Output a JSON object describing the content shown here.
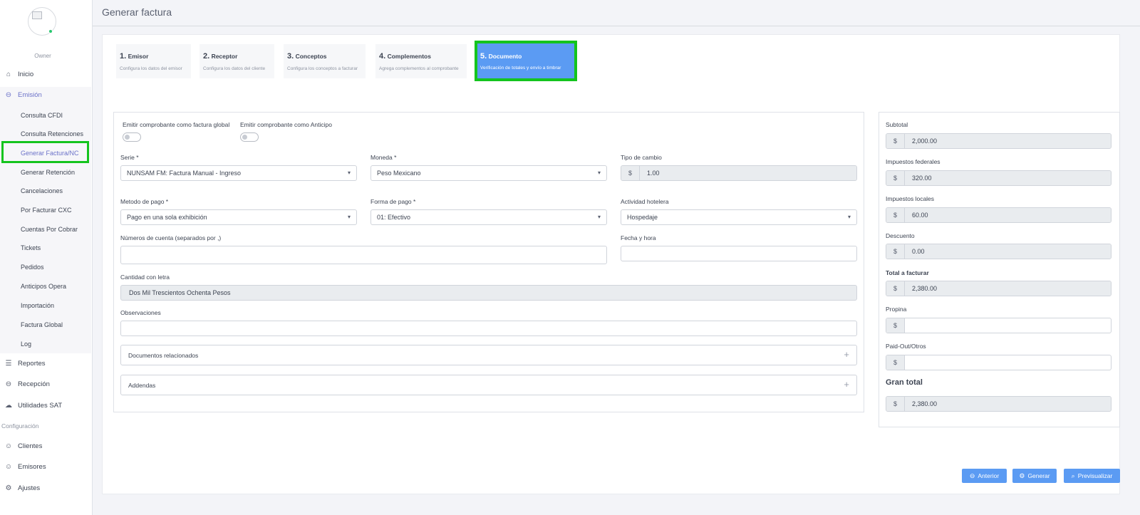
{
  "sidebar": {
    "role": "Owner",
    "nav": {
      "inicio": "Inicio",
      "emision": "Emisión",
      "reportes": "Reportes",
      "recepcion": "Recepción",
      "utilidades": "Utilidades SAT",
      "clientes": "Clientes",
      "emisores": "Emisores",
      "ajustes": "Ajustes"
    },
    "submenu": [
      "Consulta CFDI",
      "Consulta Retenciones",
      "Generar Factura/NC",
      "Generar Retención",
      "Cancelaciones",
      "Por Facturar CXC",
      "Cuentas Por Cobrar",
      "Tickets",
      "Pedidos",
      "Anticipos Opera",
      "Importación",
      "Factura Global",
      "Log"
    ],
    "config_label": "Configuración"
  },
  "header": {
    "title": "Generar factura"
  },
  "steps": [
    {
      "num": "1.",
      "title": "Emisor",
      "desc": "Configura los datos del emisor"
    },
    {
      "num": "2.",
      "title": "Receptor",
      "desc": "Configura los datos del cliente"
    },
    {
      "num": "3.",
      "title": "Conceptos",
      "desc": "Configura los conceptos a facturar"
    },
    {
      "num": "4.",
      "title": "Complementos",
      "desc": "Agrega complementos al comprobante"
    },
    {
      "num": "5.",
      "title": "Documento",
      "desc": "Verificación de totales y envío a timbrar"
    }
  ],
  "form": {
    "global_label": "Emitir comprobante como factura global",
    "anticipo_label": "Emitir comprobante como Anticipo",
    "serie_label": "Serie *",
    "serie_value": "NUNSAM FM: Factura Manual - Ingreso",
    "moneda_label": "Moneda *",
    "moneda_value": "Peso Mexicano",
    "tipo_cambio_label": "Tipo de cambio",
    "tipo_cambio_prefix": "$",
    "tipo_cambio_value": "1.00",
    "metodo_label": "Metodo de pago *",
    "metodo_value": "Pago en una sola exhibición",
    "forma_label": "Forma de pago *",
    "forma_value": "01: Efectivo",
    "actividad_label": "Actividad hotelera",
    "actividad_value": "Hospedaje",
    "cuentas_label": "Números de cuenta (separados por ,)",
    "cuentas_value": "",
    "fecha_label": "Fecha y hora",
    "fecha_value": "",
    "letra_label": "Cantidad con letra",
    "letra_value": "Dos Mil Trescientos Ochenta Pesos",
    "obs_label": "Observaciones",
    "obs_value": "",
    "docs_label": "Documentos relacionados",
    "addendas_label": "Addendas"
  },
  "totals": {
    "currency": "$",
    "subtotal_label": "Subtotal",
    "subtotal_value": "2,000.00",
    "federales_label": "Impuestos federales",
    "federales_value": "320.00",
    "locales_label": "Impuestos locales",
    "locales_value": "60.00",
    "descuento_label": "Descuento",
    "descuento_value": "0.00",
    "total_label": "Total a facturar",
    "total_value": "2,380.00",
    "propina_label": "Propina",
    "propina_value": "",
    "paidout_label": "Paid-Out/Otros",
    "paidout_value": "",
    "gran_label": "Gran total",
    "gran_value": "2,380.00"
  },
  "actions": {
    "anterior": "Anterior",
    "generar": "Generar",
    "previsualizar": "Previsualizar"
  },
  "colors": {
    "accent": "#5b9bf3",
    "highlight": "#14c41e",
    "menu_active": "#6c72c9"
  }
}
